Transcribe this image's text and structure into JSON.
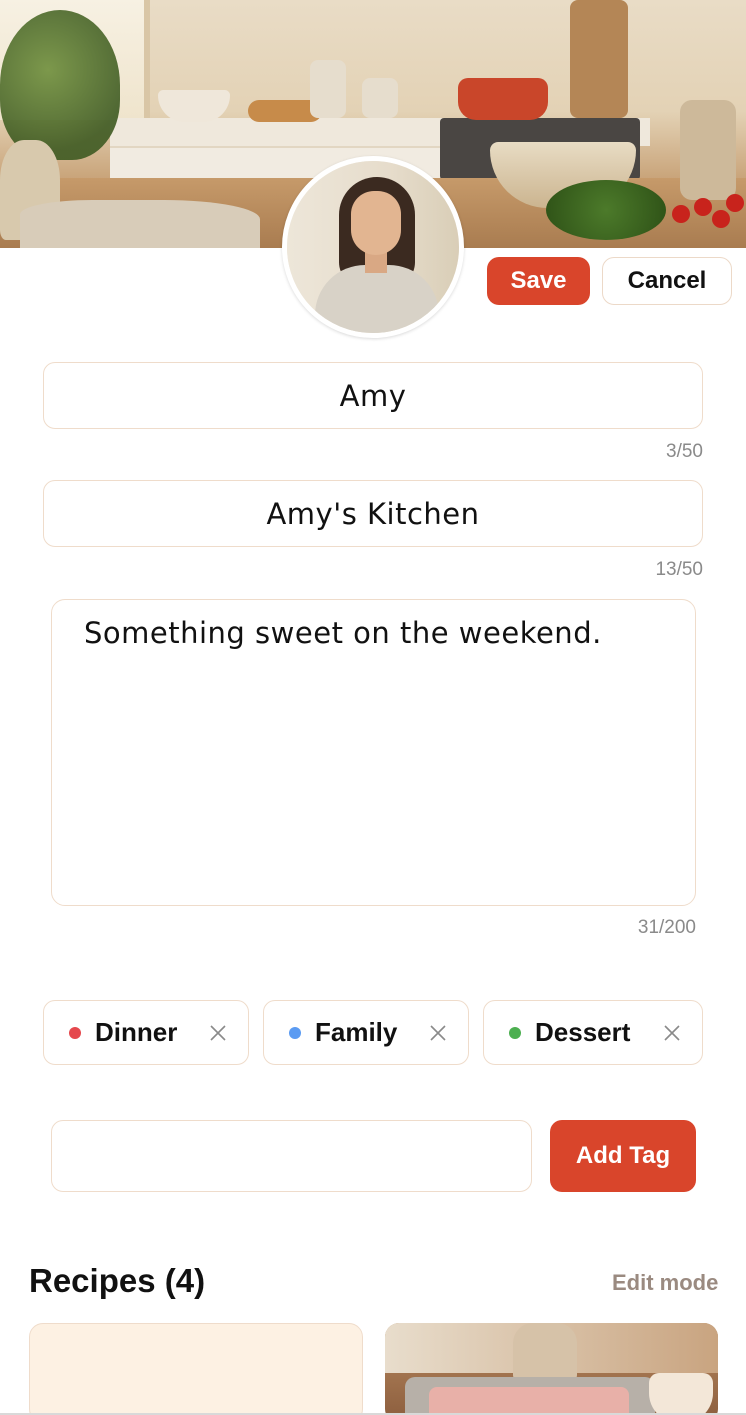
{
  "header": {
    "save_label": "Save",
    "cancel_label": "Cancel"
  },
  "profile": {
    "name": "Amy",
    "name_count": "3/50",
    "kitchen_name": "Amy's Kitchen",
    "kitchen_count": "13/50",
    "bio": "Something sweet on the weekend.",
    "bio_count": "31/200"
  },
  "tags": [
    {
      "label": "Dinner",
      "color": "#e5484d"
    },
    {
      "label": "Family",
      "color": "#5b9bf2"
    },
    {
      "label": "Dessert",
      "color": "#4caf50"
    }
  ],
  "tag_input": {
    "value": "",
    "add_label": "Add Tag"
  },
  "recipes": {
    "title": "Recipes (4)",
    "edit_mode_label": "Edit mode"
  },
  "colors": {
    "accent": "#d9452b",
    "border": "#efdccb"
  }
}
